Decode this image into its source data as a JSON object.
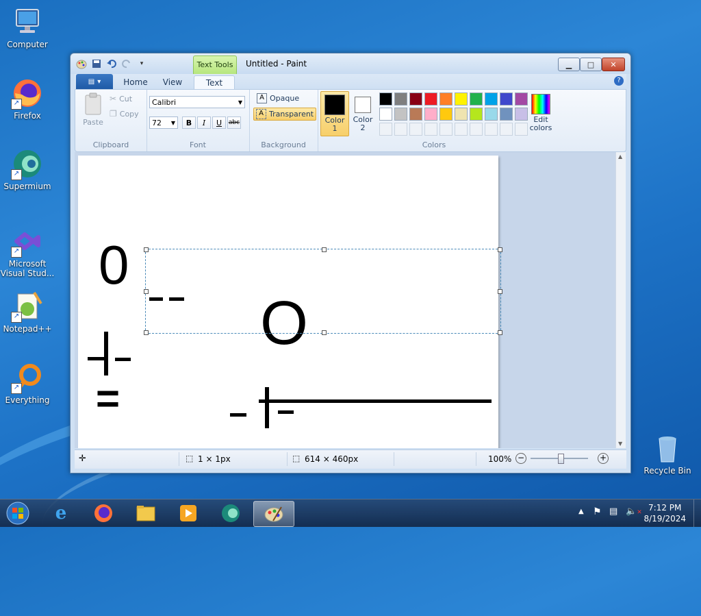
{
  "desktop": {
    "icons": [
      {
        "label": "Computer"
      },
      {
        "label": "Firefox"
      },
      {
        "label": "Supermium"
      },
      {
        "label": "Microsoft Visual Stud..."
      },
      {
        "label": "Notepad++"
      },
      {
        "label": "Everything"
      },
      {
        "label": "Recycle Bin"
      }
    ]
  },
  "window": {
    "title": "Untitled - Paint",
    "context_tab": "Text Tools",
    "tabs": [
      "Home",
      "View",
      "Text"
    ],
    "active_tab": "Text"
  },
  "ribbon": {
    "clipboard": {
      "paste": "Paste",
      "cut": "Cut",
      "copy": "Copy",
      "label": "Clipboard"
    },
    "font": {
      "family": "Calibri",
      "size": "72",
      "bold": "B",
      "italic": "I",
      "underline": "U",
      "strike": "abc",
      "label": "Font"
    },
    "background": {
      "opaque": "Opaque",
      "transparent": "Transparent",
      "label": "Background"
    },
    "colors": {
      "color1": "Color\n1",
      "color1_a": "Color",
      "color1_b": "1",
      "color2_a": "Color",
      "color2_b": "2",
      "edit_a": "Edit",
      "edit_b": "colors",
      "label": "Colors",
      "color1_value": "#000000",
      "color2_value": "#ffffff",
      "palette_row1": [
        "#000000",
        "#7f7f7f",
        "#880015",
        "#ed1c24",
        "#ff7f27",
        "#fff200",
        "#22b14c",
        "#00a2e8",
        "#3f48cc",
        "#a349a4"
      ],
      "palette_row2": [
        "#ffffff",
        "#c3c3c3",
        "#b97a57",
        "#ffaec9",
        "#ffc90e",
        "#efe4b0",
        "#b5e61d",
        "#99d9ea",
        "#7092be",
        "#c8bfe7"
      ]
    }
  },
  "canvas": {
    "glyph_zero_1": "0",
    "glyph_zero_2": "O",
    "glyph_equals": "="
  },
  "statusbar": {
    "selection_size": "1 × 1px",
    "image_size": "614 × 460px",
    "zoom": "100%"
  },
  "taskbar": {
    "time": "7:12 PM",
    "date": "8/19/2024"
  }
}
